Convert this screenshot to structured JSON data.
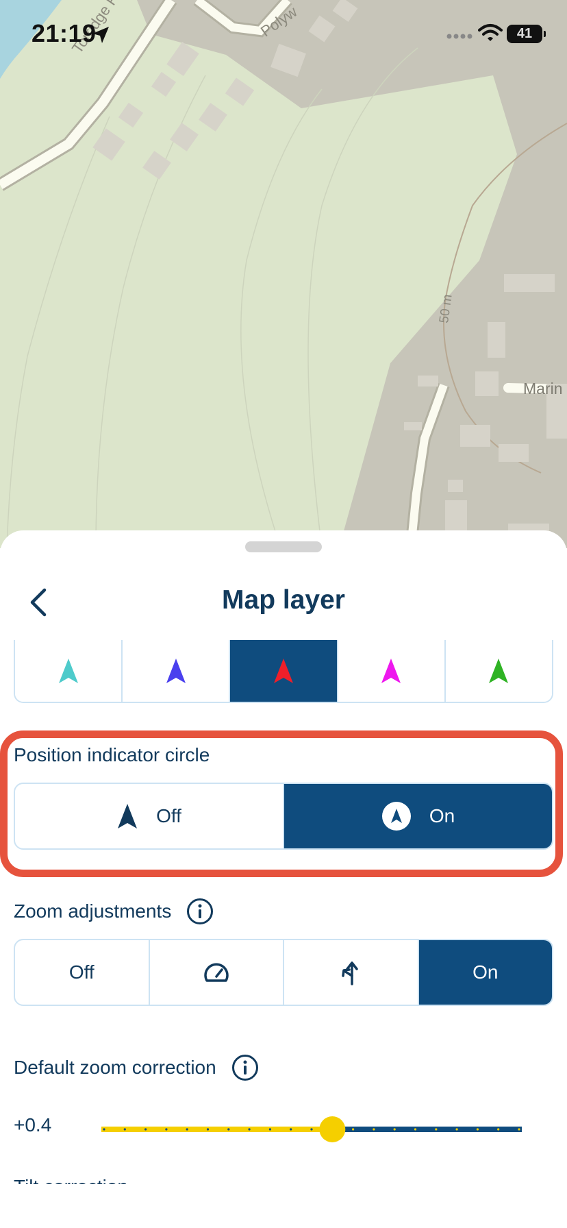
{
  "status_bar": {
    "time": "21:19",
    "battery_level": "41",
    "icons": [
      "location-arrow-icon",
      "cellular-dots-icon",
      "wifi-icon",
      "battery-icon"
    ]
  },
  "map": {
    "labels": {
      "torridge_road": "Torridge Road",
      "polyw": "Polyw",
      "contour": "50 m",
      "marin": "Marin"
    },
    "colors": {
      "land": "#dce5cb",
      "built_area": "#c7c5b9",
      "water": "#a8d4df",
      "road": "#fbfbf0"
    }
  },
  "sheet": {
    "title": "Map layer",
    "back_icon": "chevron-left-icon",
    "arrow_colors": [
      {
        "name": "cyan",
        "color": "#4ecbcb",
        "selected": false
      },
      {
        "name": "blue",
        "color": "#4a40ee",
        "selected": false
      },
      {
        "name": "red",
        "color": "#ee1f2a",
        "selected": true
      },
      {
        "name": "magenta",
        "color": "#ee18ee",
        "selected": false
      },
      {
        "name": "green",
        "color": "#2fb324",
        "selected": false
      }
    ],
    "position_indicator": {
      "label": "Position indicator circle",
      "options": [
        {
          "label": "Off",
          "icon": "navigation-arrow-icon",
          "selected": false
        },
        {
          "label": "On",
          "icon": "navigation-arrow-circle-icon",
          "selected": true
        }
      ]
    },
    "zoom_adjustments": {
      "label": "Zoom adjustments",
      "info_icon": "info-icon",
      "options": [
        {
          "label": "Off",
          "icon": null,
          "selected": false
        },
        {
          "label": "",
          "icon": "speedometer-icon",
          "selected": false
        },
        {
          "label": "",
          "icon": "turn-split-icon",
          "selected": false
        },
        {
          "label": "On",
          "icon": null,
          "selected": true
        }
      ]
    },
    "default_zoom_correction": {
      "label": "Default zoom correction",
      "info_icon": "info-icon",
      "value_label": "+0.4",
      "slider_fraction": 0.55,
      "ticks": 21
    },
    "next_section_label": "Tilt correction"
  },
  "accent": {
    "primary": "#0f4c7e",
    "slider_active": "#f5cf00",
    "highlight": "#e6533d",
    "segment_border": "#cde3f3"
  }
}
